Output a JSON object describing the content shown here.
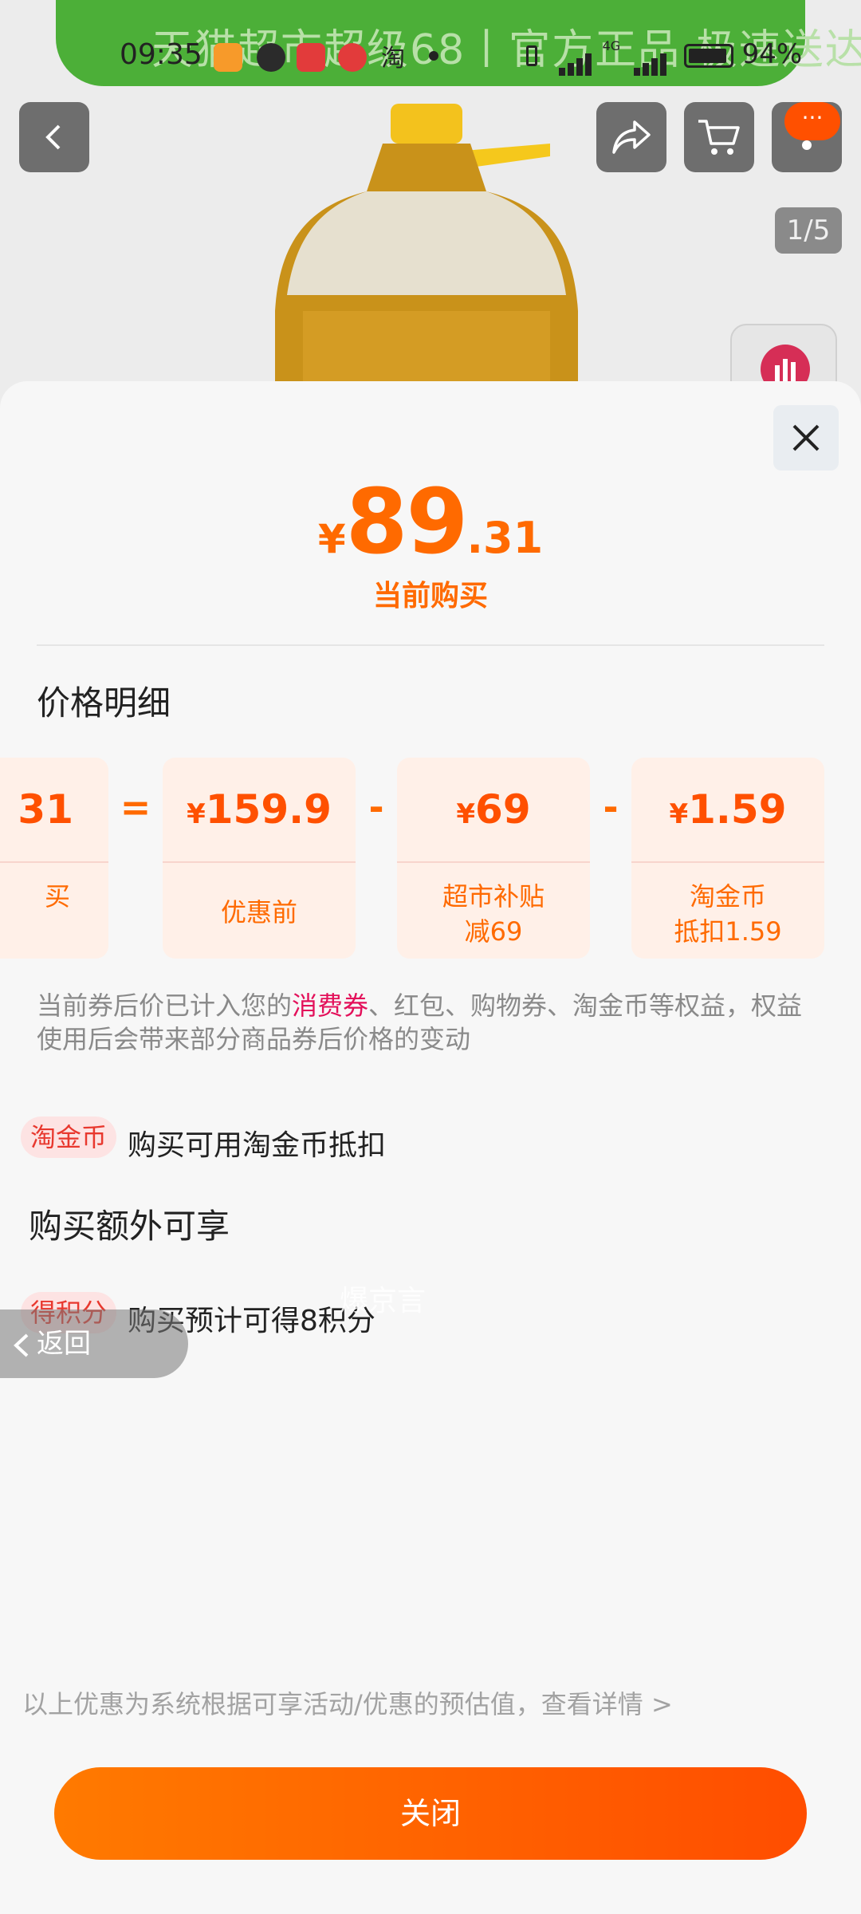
{
  "status_bar": {
    "time": "09:35",
    "battery": "94%",
    "network": "4G",
    "notification_badges": [
      "头条",
      "淘"
    ]
  },
  "banner": {
    "text": "天猫超市超级68丨官方正品 极速送达"
  },
  "product": {
    "image_indicator": "1/5"
  },
  "header_buttons": {
    "more": "···"
  },
  "sheet": {
    "price": {
      "currency": "¥",
      "integer": "89",
      "decimal": ".31",
      "caption": "当前购买"
    },
    "detail_title": "价格明细",
    "formula": {
      "cards": [
        {
          "value": "31",
          "currency": "",
          "label": "买"
        },
        {
          "value": "159.9",
          "currency": "¥",
          "label": "优惠前"
        },
        {
          "value": "69",
          "currency": "¥",
          "label": "超市补贴\n减69"
        },
        {
          "value": "1.59",
          "currency": "¥",
          "label": "淘金币\n抵扣1.59"
        }
      ],
      "operators": [
        "=",
        "-",
        "-"
      ]
    },
    "note": {
      "before": "当前券后价已计入您的",
      "highlight": "消费券",
      "after": "、红包、购物券、淘金币等权益，权益使用后会带来部分商品券后价格的变动"
    },
    "coin_row": {
      "tag": "淘金币",
      "text": "购买可用淘金币抵扣"
    },
    "extra_title": "购买额外可享",
    "points_row": {
      "tag": "得积分",
      "text": "购买预计可得8积分"
    },
    "back_label": "返回",
    "footnote": "以上优惠为系统根据可享活动/优惠的预估值，查看详情 >",
    "close_label": "关闭"
  },
  "watermark": "爆京言",
  "colors": {
    "accent": "#ff6a00",
    "highlight": "#e3105a",
    "banner": "#4caf38"
  }
}
